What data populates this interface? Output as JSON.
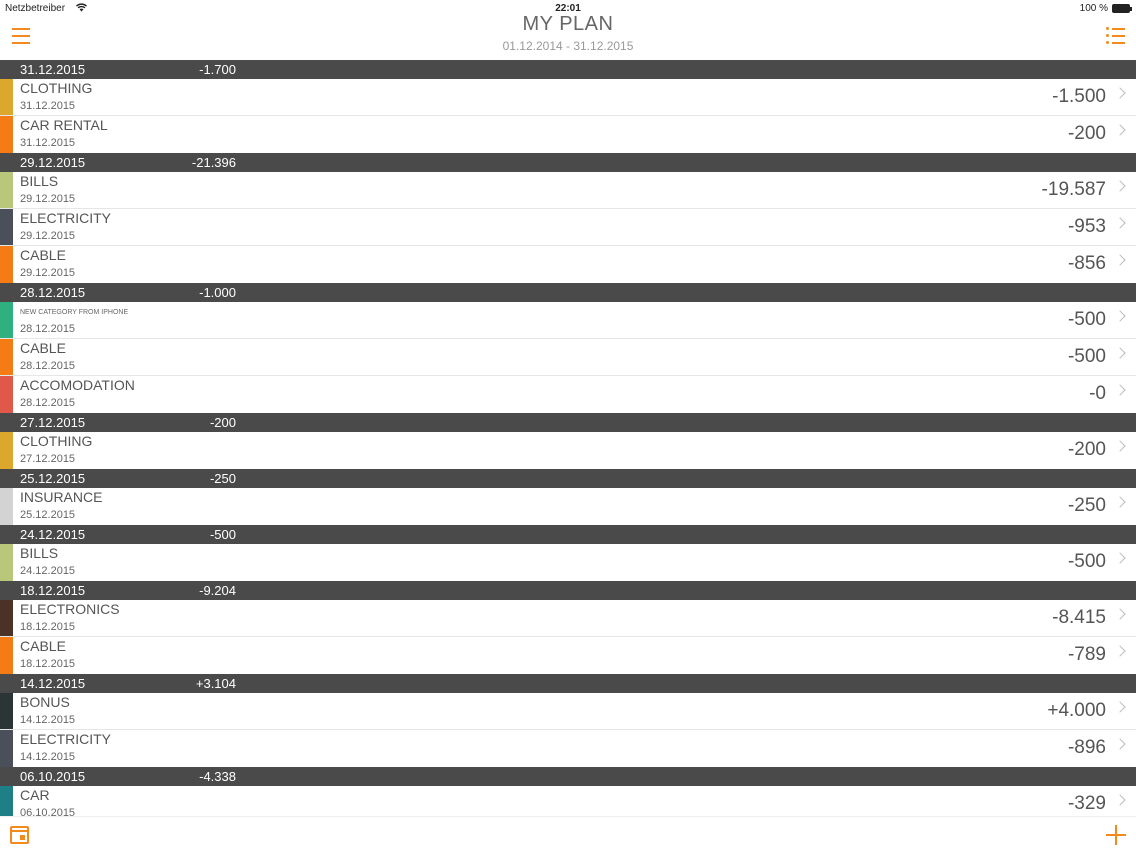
{
  "status": {
    "carrier": "Netzbetreiber",
    "time": "22:01",
    "battery": "100 %"
  },
  "nav": {
    "title": "MY PLAN",
    "subtitle": "01.12.2014 - 31.12.2015"
  },
  "colors": {
    "accent": "#f28a1e",
    "header_bg": "#4a4a4b"
  },
  "sections": [
    {
      "date": "31.12.2015",
      "sum": "-1.700",
      "items": [
        {
          "name": "CLOTHING",
          "date": "31.12.2015",
          "amount": "-1.500",
          "color": "#dca72d"
        },
        {
          "name": "CAR RENTAL",
          "date": "31.12.2015",
          "amount": "-200",
          "color": "#f57c14"
        }
      ]
    },
    {
      "date": "29.12.2015",
      "sum": "-21.396",
      "items": [
        {
          "name": "BILLS",
          "date": "29.12.2015",
          "amount": "-19.587",
          "color": "#b8c77a"
        },
        {
          "name": "ELECTRICITY",
          "date": "29.12.2015",
          "amount": "-953",
          "color": "#4a4f5a"
        },
        {
          "name": "CABLE",
          "date": "29.12.2015",
          "amount": "-856",
          "color": "#f57c14"
        }
      ]
    },
    {
      "date": "28.12.2015",
      "sum": "-1.000",
      "items": [
        {
          "name": "NEW CATEGORY FROM IPHONE",
          "date": "28.12.2015",
          "amount": "-500",
          "color": "#2fb07f",
          "small": true
        },
        {
          "name": "CABLE",
          "date": "28.12.2015",
          "amount": "-500",
          "color": "#f57c14"
        },
        {
          "name": "ACCOMODATION",
          "date": "28.12.2015",
          "amount": "-0",
          "color": "#e0584a"
        }
      ]
    },
    {
      "date": "27.12.2015",
      "sum": "-200",
      "items": [
        {
          "name": "CLOTHING",
          "date": "27.12.2015",
          "amount": "-200",
          "color": "#dca72d"
        }
      ]
    },
    {
      "date": "25.12.2015",
      "sum": "-250",
      "items": [
        {
          "name": "INSURANCE",
          "date": "25.12.2015",
          "amount": "-250",
          "color": "#d3d3d3"
        }
      ]
    },
    {
      "date": "24.12.2015",
      "sum": "-500",
      "items": [
        {
          "name": "BILLS",
          "date": "24.12.2015",
          "amount": "-500",
          "color": "#b8c77a"
        }
      ]
    },
    {
      "date": "18.12.2015",
      "sum": "-9.204",
      "items": [
        {
          "name": "ELECTRONICS",
          "date": "18.12.2015",
          "amount": "-8.415",
          "color": "#4a3226"
        },
        {
          "name": "CABLE",
          "date": "18.12.2015",
          "amount": "-789",
          "color": "#f57c14"
        }
      ]
    },
    {
      "date": "14.12.2015",
      "sum": "+3.104",
      "items": [
        {
          "name": "BONUS",
          "date": "14.12.2015",
          "amount": "+4.000",
          "color": "#2c3535"
        },
        {
          "name": "ELECTRICITY",
          "date": "14.12.2015",
          "amount": "-896",
          "color": "#4a4f5a"
        }
      ]
    },
    {
      "date": "06.10.2015",
      "sum": "-4.338",
      "items": [
        {
          "name": "CAR",
          "date": "06.10.2015",
          "amount": "-329",
          "color": "#1f7f86"
        }
      ]
    }
  ]
}
